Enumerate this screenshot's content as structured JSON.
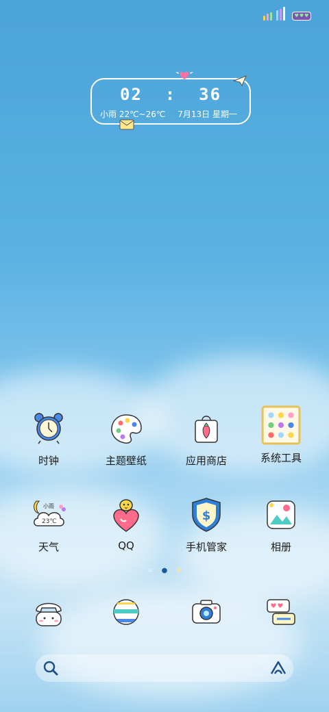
{
  "status": {
    "bar_colors": [
      "#ffd04e",
      "#ff9fc4",
      "#9be49b",
      "#9fd7ff",
      "#c79bf0",
      "#ffffff"
    ],
    "battery_icon": "hearts"
  },
  "clock": {
    "hour": "02",
    "minute": "36",
    "weather": "小雨 22℃~26℃",
    "date": "7月13日 星期一"
  },
  "apps": [
    {
      "label": "时钟",
      "icon": "alarm-clock-icon"
    },
    {
      "label": "主题壁纸",
      "icon": "palette-icon"
    },
    {
      "label": "应用商店",
      "icon": "shopping-bag-icon"
    },
    {
      "label": "系统工具",
      "icon": "tools-folder-icon"
    },
    {
      "label": "天气",
      "icon": "weather-cloud-icon",
      "badge_text": "小雨",
      "temp_text": "23℃"
    },
    {
      "label": "QQ",
      "icon": "qq-penguin-icon"
    },
    {
      "label": "手机管家",
      "icon": "shield-icon"
    },
    {
      "label": "相册",
      "icon": "photo-album-icon"
    }
  ],
  "page_indicator": {
    "icons": [
      "menu-dot",
      "leaf-dot",
      "clover-dot"
    ],
    "current": 1
  },
  "dock": [
    {
      "icon": "phone-icon"
    },
    {
      "icon": "browser-ball-icon"
    },
    {
      "icon": "camera-icon"
    },
    {
      "icon": "messages-icon"
    }
  ],
  "search": {
    "icon": "search-icon",
    "assistant_icon": "assistant-icon"
  }
}
